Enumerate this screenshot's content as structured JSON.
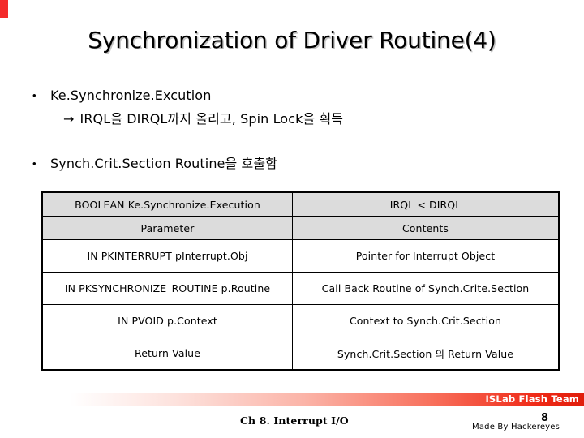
{
  "slide": {
    "title": "Synchronization of Driver Routine(4)",
    "accent_color": "#F42A2A",
    "header_bg_color": "#DCDCDC"
  },
  "bullets": [
    {
      "marker": "•",
      "text": "Ke.Synchronize.Excution",
      "sub": {
        "arrow": "→",
        "text": "IRQL을 DIRQL까지 올리고, Spin Lock을 획득"
      }
    },
    {
      "marker": "•",
      "text": "Synch.Crit.Section Routine을 호출함"
    }
  ],
  "table": {
    "signature_row": {
      "left": "BOOLEAN Ke.Synchronize.Execution",
      "right": "IRQL < DIRQL"
    },
    "column_headers": {
      "left": "Parameter",
      "right": "Contents"
    },
    "rows": [
      {
        "parameter": "IN PKINTERRUPT pInterrupt.Obj",
        "contents": "Pointer for Interrupt Object"
      },
      {
        "parameter": "IN PKSYNCHRONIZE_ROUTINE p.Routine",
        "contents": "Call Back Routine of Synch.Crite.Section"
      },
      {
        "parameter": "IN PVOID p.Context",
        "contents": "Context to Synch.Crit.Section"
      },
      {
        "parameter": "Return Value",
        "contents": "Synch.Crit.Section 의 Return Value"
      }
    ]
  },
  "footer": {
    "team": "ISLab Flash Team",
    "chapter": "Ch 8. Interrupt I/O",
    "made_by": "Made By Hackereyes",
    "page_number": "8"
  }
}
